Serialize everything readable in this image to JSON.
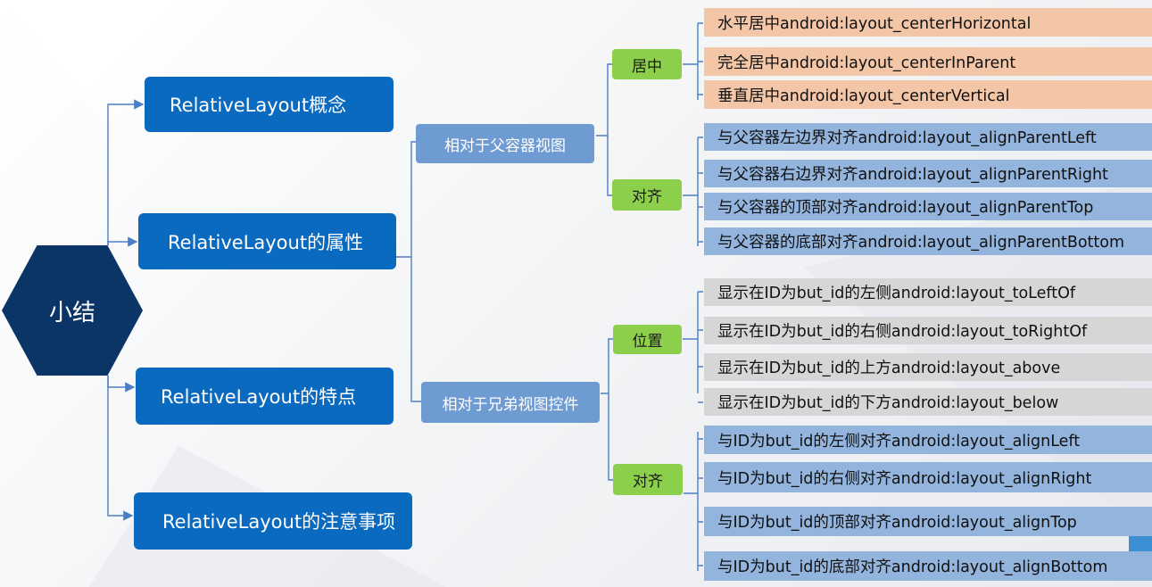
{
  "center": {
    "label": "小结"
  },
  "level1": [
    {
      "label": "RelativeLayout概念"
    },
    {
      "label": "RelativeLayout的属性"
    },
    {
      "label": "RelativeLayout的特点"
    },
    {
      "label": "RelativeLayout的注意事项"
    }
  ],
  "level2": [
    {
      "label": "相对于父容器视图"
    },
    {
      "label": "相对于兄弟视图控件"
    }
  ],
  "level3": [
    {
      "label": "居中"
    },
    {
      "label": "对齐"
    },
    {
      "label": "位置"
    },
    {
      "label": "对齐"
    }
  ],
  "leaves": {
    "center": [
      "水平居中android:layout_centerHorizontal",
      "完全居中android:layout_centerInParent",
      "垂直居中android:layout_centerVertical"
    ],
    "parent_align": [
      "与父容器左边界对齐android:layout_alignParentLeft",
      "与父容器右边界对齐android:layout_alignParentRight",
      "与父容器的顶部对齐android:layout_alignParentTop",
      "与父容器的底部对齐android:layout_alignParentBottom"
    ],
    "position": [
      "显示在ID为but_id的左侧android:layout_toLeftOf",
      "显示在ID为but_id的右侧android:layout_toRightOf",
      "显示在ID为but_id的上方android:layout_above",
      "显示在ID为but_id的下方android:layout_below"
    ],
    "sibling_align": [
      "与ID为but_id的左侧对齐android:layout_alignLeft",
      "与ID为but_id的右侧对齐android:layout_alignRight",
      "与ID为but_id的顶部对齐android:layout_alignTop",
      "与ID为but_id的底部对齐android:layout_alignBottom"
    ]
  },
  "colors": {
    "center_hex": "#0b3566",
    "level1": "#0a6abf",
    "level2": "#6f9bd3",
    "level3": "#8ccf4b",
    "leaf_center": "#f2c6a6",
    "leaf_align": "#92b4dd",
    "leaf_position": "#d6d6d6",
    "connector": "#4a7fc4"
  }
}
